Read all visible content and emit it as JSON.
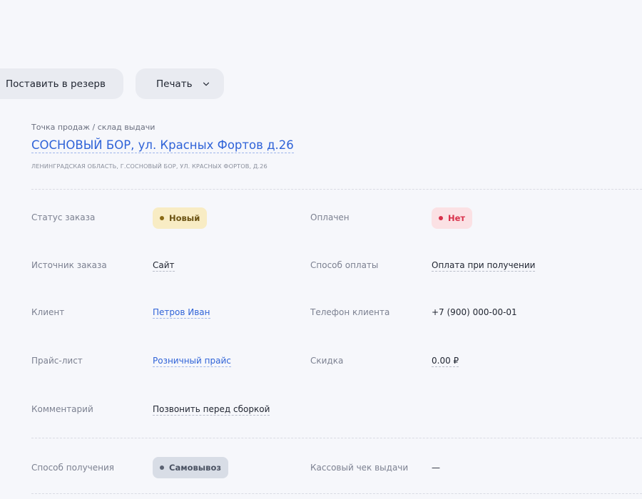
{
  "toolbar": {
    "reserve_label": "Поставить в резерв",
    "print_label": "Печать"
  },
  "warehouse": {
    "label": "Точка продаж / склад выдачи",
    "name": "СОСНОВЫЙ БОР, ул. Красных Фортов д.26",
    "address": "ЛЕНИНГРАДСКАЯ ОБЛАСТЬ, Г.СОСНОВЫЙ БОР, УЛ. КРАСНЫХ ФОРТОВ, Д.26"
  },
  "fields": {
    "order_status": {
      "label": "Статус заказа",
      "value": "Новый"
    },
    "paid": {
      "label": "Оплачен",
      "value": "Нет"
    },
    "order_source": {
      "label": "Источник заказа",
      "value": "Сайт"
    },
    "payment_method": {
      "label": "Способ оплаты",
      "value": "Оплата при получении"
    },
    "client": {
      "label": "Клиент",
      "value": "Петров Иван"
    },
    "client_phone": {
      "label": "Телефон клиента",
      "value": "+7 (900) 000-00-01"
    },
    "price_list": {
      "label": "Прайс-лист",
      "value": "Розничный прайс"
    },
    "discount": {
      "label": "Скидка",
      "value": "0.00 ₽"
    },
    "comment": {
      "label": "Комментарий",
      "value": "Позвонить перед сборкой"
    },
    "delivery_method": {
      "label": "Способ получения",
      "value": "Самовывоз"
    },
    "receipt": {
      "label": "Кассовый чек выдачи",
      "value": "—"
    }
  },
  "icons": {
    "print_chevron": "chevron-down-icon",
    "status_dot": "dot-icon"
  },
  "colors": {
    "link": "#2f63d8",
    "badge_new_bg": "#f8ecc4",
    "badge_no_bg": "#fbe1e4",
    "badge_pickup_bg": "#d8dde6"
  }
}
